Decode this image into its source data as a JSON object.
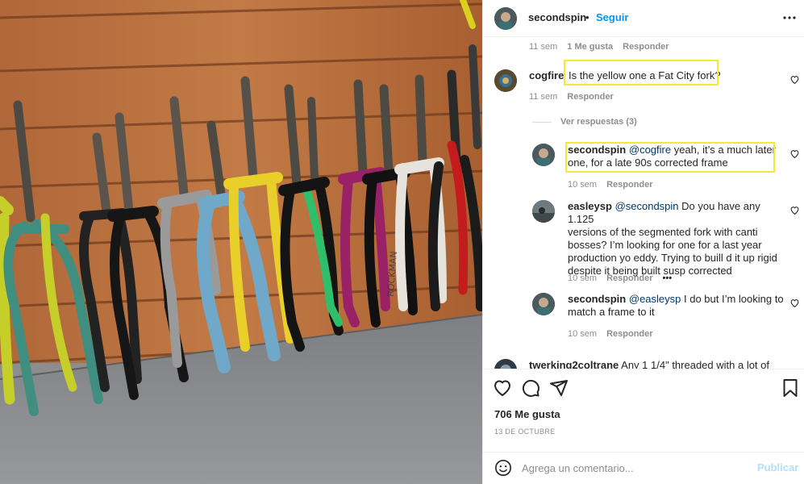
{
  "post": {
    "username": "secondspin",
    "dot": "•",
    "follow_label": "Seguir",
    "more_icon": "more-horizontal-icon",
    "caption_meta": {
      "time": "11 sem",
      "likes": "1 Me gusta",
      "reply": "Responder"
    }
  },
  "comments": [
    {
      "username": "cogfire",
      "text": "Is the yellow one a Fat City fork?",
      "time": "11 sem",
      "reply": "Responder"
    }
  ],
  "view_replies": "Ver respuestas (3)",
  "replies": [
    {
      "username": "secondspin",
      "mention": "@cogfire",
      "text_line1": " yeah, it’s a much later",
      "text_line2": "one, for a late 90s corrected frame",
      "time": "10 sem",
      "reply": "Responder"
    },
    {
      "username": "easleysp",
      "mention": "@secondspin",
      "text_line1": " Do you have any 1.125",
      "text_line2": "versions of the segmented fork with canti",
      "text_line3": "bosses? I’m looking for one for a last year",
      "text_line4": "production yo eddy. Trying to buill d it up rigid",
      "text_line5": "despite it being built susp corrected",
      "time": "10 sem",
      "reply": "Responder",
      "more": "•••"
    },
    {
      "username": "secondspin",
      "mention": "@easleysp",
      "text_line1": " I do but I’m looking to",
      "text_line2": "match a frame to it",
      "time": "10 sem",
      "reply": "Responder"
    }
  ],
  "partial_comment": {
    "username": "twerking2coltrane",
    "text": " Any 1 1/4\" threaded with a lot of"
  },
  "footer": {
    "likes": "706 Me gusta",
    "date": "13 DE OCTUBRE",
    "comment_placeholder": "Agrega un comentario...",
    "publish_label": "Publicar"
  },
  "colors": {
    "link": "#0095f6",
    "highlight": "#f2ea35",
    "muted": "#8e8e8e",
    "publish_disabled": "#b2dffc"
  },
  "icons": [
    "heart-icon",
    "comment-icon",
    "share-icon",
    "bookmark-icon",
    "emoji-icon"
  ]
}
